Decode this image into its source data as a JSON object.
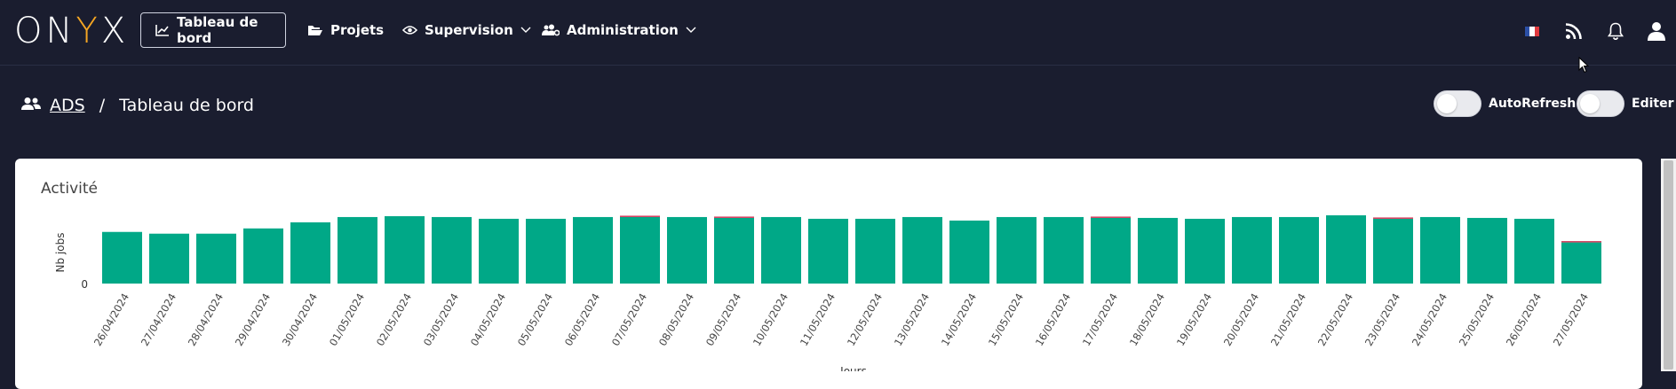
{
  "app": {
    "logo_text_1": "ON",
    "logo_text_y": "Y",
    "logo_text_2": "X"
  },
  "nav": {
    "items": [
      {
        "label": "Tableau de bord",
        "icon": "chart-line-icon",
        "active": true,
        "dropdown": false
      },
      {
        "label": "Projets",
        "icon": "folder-open-icon",
        "active": false,
        "dropdown": false
      },
      {
        "label": "Supervision",
        "icon": "eye-icon",
        "active": false,
        "dropdown": true
      },
      {
        "label": "Administration",
        "icon": "users-cog-icon",
        "active": false,
        "dropdown": true
      }
    ],
    "right_icons": [
      "french-flag-icon",
      "rss-icon",
      "bell-icon",
      "user-icon"
    ]
  },
  "breadcrumb": {
    "group_icon": "users-icon",
    "link": "ADS",
    "separator": "/",
    "current": "Tableau de bord"
  },
  "toggles": {
    "autorefresh_label": "AutoRefresh",
    "editer_label": "Editer"
  },
  "card": {
    "title": "Activité"
  },
  "colors": {
    "bar": "#00a887",
    "bar_top": "#d23a5a",
    "background": "#1a1d2f"
  },
  "chart_data": {
    "type": "bar",
    "stacked": true,
    "ylabel": "Nb jobs",
    "xlabel": "Jours",
    "y_tick_labels": [
      "0"
    ],
    "categories": [
      "26/04/2024",
      "27/04/2024",
      "28/04/2024",
      "29/04/2024",
      "30/04/2024",
      "01/05/2024",
      "02/05/2024",
      "03/05/2024",
      "04/05/2024",
      "05/05/2024",
      "06/05/2024",
      "07/05/2024",
      "08/05/2024",
      "09/05/2024",
      "10/05/2024",
      "11/05/2024",
      "12/05/2024",
      "13/05/2024",
      "14/05/2024",
      "15/05/2024",
      "16/05/2024",
      "17/05/2024",
      "18/05/2024",
      "19/05/2024",
      "20/05/2024",
      "21/05/2024",
      "22/05/2024",
      "23/05/2024",
      "24/05/2024",
      "25/05/2024",
      "26/05/2024",
      "27/05/2024"
    ],
    "series": [
      {
        "values": [
          59,
          57,
          57,
          63,
          70,
          76,
          77,
          76,
          74,
          74,
          76,
          76,
          76,
          75,
          76,
          74,
          74,
          76,
          72,
          76,
          76,
          75,
          75,
          74,
          76,
          76,
          78,
          74,
          76,
          75,
          74,
          47
        ]
      },
      {
        "values": [
          0,
          0,
          0,
          0,
          0,
          0,
          0,
          0,
          0,
          0,
          0,
          1,
          0,
          1,
          0,
          0,
          0,
          0,
          0,
          0,
          0,
          1,
          0,
          0,
          0,
          0,
          0,
          1,
          0,
          0,
          0,
          1
        ]
      }
    ],
    "ylim": [
      0,
      80
    ]
  }
}
